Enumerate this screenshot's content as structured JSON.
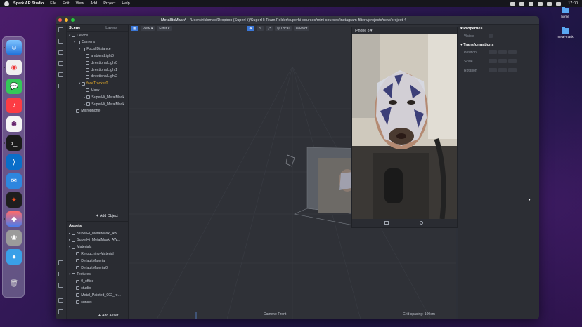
{
  "menubar": {
    "app_name": "Spark AR Studio",
    "items": [
      "File",
      "Edit",
      "View",
      "Add",
      "Project",
      "Help"
    ],
    "clock": "17:00"
  },
  "desktop": {
    "icons": [
      {
        "label": "home"
      },
      {
        "label": "metal-mask"
      }
    ]
  },
  "window": {
    "title_bold": "MetallicMask*",
    "title_path": " - /Users/riklomas/Dropbox (SuperHi)/SuperHi Team Folder/superhi-courses/mini-courses/instagram-filters/projects/new/project-4"
  },
  "scene_panel": {
    "tabs": [
      "Scene",
      "Layers"
    ],
    "tree": [
      {
        "label": "Device",
        "indent": 0,
        "caret": "▾"
      },
      {
        "label": "Camera",
        "indent": 1,
        "caret": "▾"
      },
      {
        "label": "Focal Distance",
        "indent": 2,
        "caret": "▾"
      },
      {
        "label": "ambientLight0",
        "indent": 3,
        "caret": ""
      },
      {
        "label": "directionalLight0",
        "indent": 3,
        "caret": ""
      },
      {
        "label": "directionalLight1",
        "indent": 3,
        "caret": ""
      },
      {
        "label": "directionalLight2",
        "indent": 3,
        "caret": ""
      },
      {
        "label": "faceTracker0",
        "indent": 2,
        "caret": "▾",
        "selected": true
      },
      {
        "label": "Mask",
        "indent": 3,
        "caret": ""
      },
      {
        "label": "SuperHi_MetalMask...",
        "indent": 3,
        "caret": "▸"
      },
      {
        "label": "SuperHi_MetalMask...",
        "indent": 3,
        "caret": "▸"
      },
      {
        "label": "Microphone",
        "indent": 1,
        "caret": ""
      }
    ],
    "add_object": "Add Object"
  },
  "assets_panel": {
    "title": "Assets",
    "tree": [
      {
        "label": "SuperHi_MetalMask_AW...",
        "indent": 0,
        "caret": "▸"
      },
      {
        "label": "SuperHi_MetalMask_AW...",
        "indent": 0,
        "caret": "▸"
      },
      {
        "label": "Materials",
        "indent": 0,
        "caret": "▾"
      },
      {
        "label": "Retouching-Material",
        "indent": 1,
        "caret": ""
      },
      {
        "label": "DefaultMaterial",
        "indent": 1,
        "caret": ""
      },
      {
        "label": "DefaultMaterial0",
        "indent": 1,
        "caret": ""
      },
      {
        "label": "Textures",
        "indent": 0,
        "caret": "▾"
      },
      {
        "label": "0_office",
        "indent": 1,
        "caret": ""
      },
      {
        "label": "studio",
        "indent": 1,
        "caret": ""
      },
      {
        "label": "Metal_Painted_002_ro...",
        "indent": 1,
        "caret": ""
      },
      {
        "label": "sunset",
        "indent": 1,
        "caret": ""
      }
    ],
    "add_asset": "Add Asset"
  },
  "viewport": {
    "view_label": "View",
    "filter_label": "Filter",
    "local_label": "Local",
    "pivot_label": "Pivot",
    "camera_status": "Camera: Front",
    "grid_status": "Grid spacing: 100cm"
  },
  "preview": {
    "device": "iPhone 8"
  },
  "properties": {
    "title": "Properties",
    "visible_label": "Visible",
    "transformations_title": "Transformations",
    "rows": [
      "Position",
      "Scale",
      "Rotation"
    ]
  },
  "colors": {
    "accent": "#3a76d6",
    "selected": "#f0b429"
  }
}
